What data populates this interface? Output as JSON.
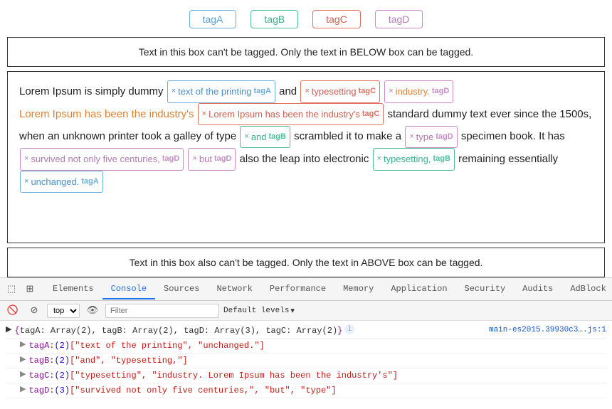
{
  "tags": [
    {
      "id": "tagA",
      "label": "tagA",
      "class": "tagA"
    },
    {
      "id": "tagB",
      "label": "tagB",
      "class": "tagB"
    },
    {
      "id": "tagC",
      "label": "tagC",
      "class": "tagC"
    },
    {
      "id": "tagD",
      "label": "tagD",
      "class": "tagD"
    }
  ],
  "info_box_top": "Text in this box can't be tagged. Only the text in BELOW box can be tagged.",
  "info_box_bottom": "Text in this box also can't be tagged. Only the text in ABOVE box can be tagged.",
  "devtools": {
    "tabs": [
      {
        "label": "Elements",
        "active": false
      },
      {
        "label": "Console",
        "active": true
      },
      {
        "label": "Sources",
        "active": false
      },
      {
        "label": "Network",
        "active": false
      },
      {
        "label": "Performance",
        "active": false
      },
      {
        "label": "Memory",
        "active": false
      },
      {
        "label": "Application",
        "active": false
      },
      {
        "label": "Security",
        "active": false
      },
      {
        "label": "Audits",
        "active": false
      },
      {
        "label": "AdBlock",
        "active": false
      }
    ],
    "toolbar": {
      "select_value": "top",
      "filter_placeholder": "Filter",
      "levels_label": "Default levels"
    },
    "console_lines": [
      {
        "text": "{tagA: Array(2), tagB: Array(2), tagD: Array(3), tagC: Array(2)}",
        "link": "main-es2015.39930c3….js:1",
        "has_info": true
      },
      {
        "indent": true,
        "arrow": true,
        "key": "tagA",
        "value": "(2) [\"text of the printing\", \"unchanged.\"]"
      },
      {
        "indent": true,
        "arrow": true,
        "key": "tagB",
        "value": "(2) [\"and\", \"typesetting,\"]"
      },
      {
        "indent": true,
        "arrow": true,
        "key": "tagC",
        "value": "(2) [\"typesetting\", \"industry. Lorem Ipsum has been the industry's\"]"
      },
      {
        "indent": true,
        "arrow": true,
        "key": "tagD",
        "value": "(3) [\"survived not only five centuries,\", \"but\", \"type\"]"
      }
    ]
  }
}
